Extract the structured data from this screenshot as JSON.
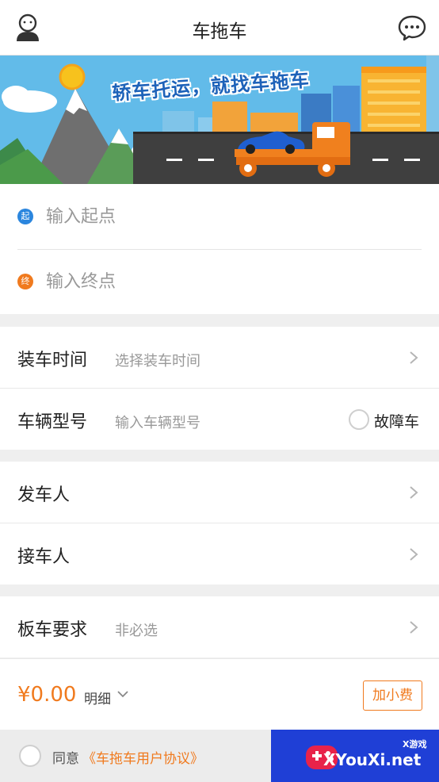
{
  "header": {
    "title": "车拖车",
    "user_icon": "user-profile-icon",
    "message_icon": "chat-bubble-icon"
  },
  "banner": {
    "slogan": "轿车托运，就找车拖车"
  },
  "address": {
    "start_badge": "起",
    "start_placeholder": "输入起点",
    "end_badge": "终",
    "end_placeholder": "输入终点"
  },
  "loading_time": {
    "label": "装车时间",
    "hint": "选择装车时间"
  },
  "vehicle_model": {
    "label": "车辆型号",
    "hint": "输入车辆型号",
    "fault_label": "故障车"
  },
  "sender": {
    "label": "发车人"
  },
  "receiver": {
    "label": "接车人"
  },
  "flatbed": {
    "label": "板车要求",
    "hint": "非必选"
  },
  "price": {
    "amount": "¥0.00",
    "detail_label": "明细",
    "tip_button": "加小费"
  },
  "agreement": {
    "prefix": "同意",
    "link": "《车拖车用户协议》"
  },
  "watermark": {
    "tag": "X游戏",
    "site": "XYouXi.net"
  },
  "colors": {
    "accent": "#f07a1e",
    "start_dot": "#2b86de",
    "end_dot": "#f07a1e",
    "background": "#efefef"
  }
}
